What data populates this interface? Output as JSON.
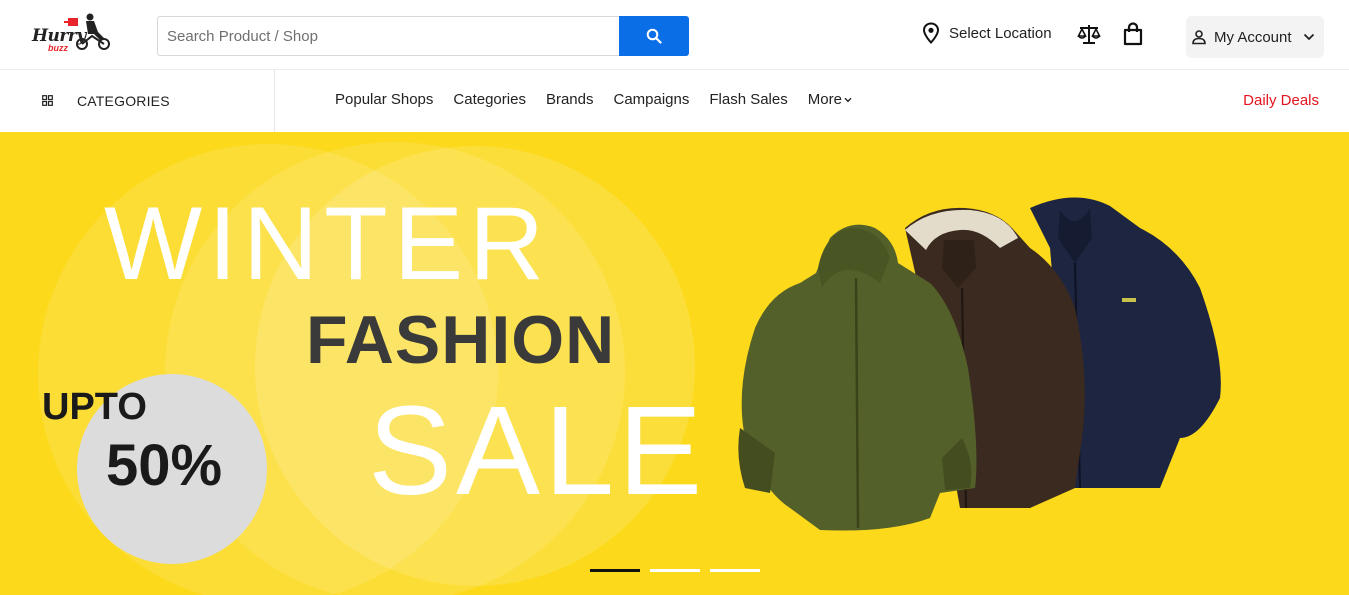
{
  "header": {
    "logo": {
      "text": "Hurry",
      "sub": "buzz"
    },
    "search": {
      "placeholder": "Search Product / Shop",
      "button_icon": "search-icon"
    },
    "location_label": "Select Location",
    "compare_icon": "scale-icon",
    "cart_icon": "shopping-bag-icon",
    "account_label": "My Account"
  },
  "nav": {
    "categories_label": "CATEGORIES",
    "links": [
      "Popular Shops",
      "Categories",
      "Brands",
      "Campaigns",
      "Flash Sales"
    ],
    "more_label": "More",
    "daily_deals_label": "Daily Deals"
  },
  "banner": {
    "line1": "WINTER",
    "line2": "FASHION",
    "line3": "SALE",
    "upto": "UPTO",
    "discount": "50%",
    "slides": 3,
    "active_slide": 0
  },
  "colors": {
    "accent": "#0a6ee6",
    "banner_bg": "#fcd91a",
    "deals": "#e2141e"
  }
}
